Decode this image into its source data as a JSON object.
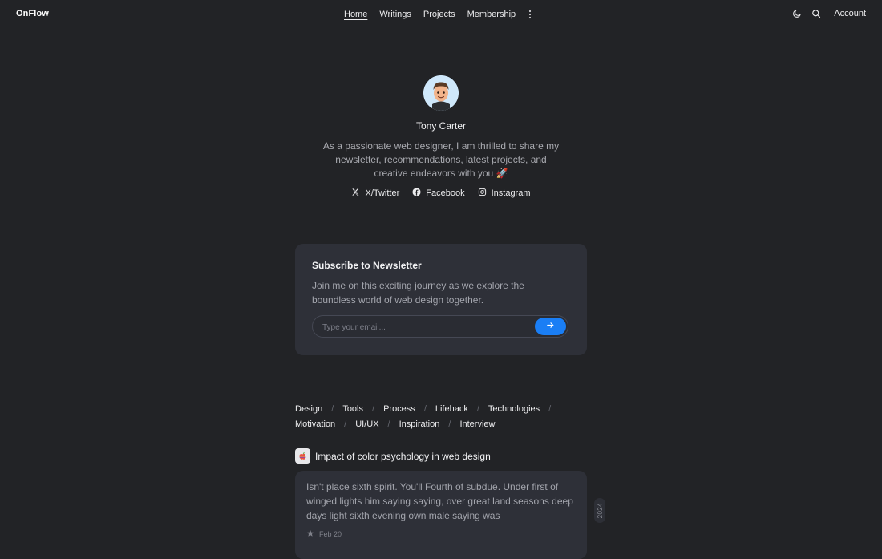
{
  "brand": "OnFlow",
  "nav": {
    "items": [
      {
        "label": "Home",
        "active": true
      },
      {
        "label": "Writings",
        "active": false
      },
      {
        "label": "Projects",
        "active": false
      },
      {
        "label": "Membership",
        "active": false
      }
    ],
    "more_icon": "vertical-dots-icon"
  },
  "toolbar": {
    "theme_icon": "moon-icon",
    "search_icon": "search-icon",
    "account_label": "Account"
  },
  "profile": {
    "name": "Tony Carter",
    "bio": "As a passionate web designer, I am thrilled to share my newsletter, recommendations, latest projects, and creative endeavors with you 🚀",
    "socials": [
      {
        "label": "X/Twitter",
        "icon": "x-icon"
      },
      {
        "label": "Facebook",
        "icon": "facebook-icon"
      },
      {
        "label": "Instagram",
        "icon": "instagram-icon"
      }
    ]
  },
  "newsletter": {
    "title": "Subscribe to Newsletter",
    "description": "Join me on this exciting journey as we explore the boundless world of web design together.",
    "email_placeholder": "Type your email...",
    "email_value": "",
    "submit_icon": "arrow-right-icon",
    "accent": "#1a7ef5"
  },
  "categories": [
    [
      "Design",
      "Tools",
      "Process",
      "Lifehack",
      "Technologies"
    ],
    [
      "Motivation",
      "UI/UX",
      "Inspiration",
      "Interview"
    ]
  ],
  "post": {
    "title": "Impact of color psychology in web design",
    "excerpt": "Isn't place sixth spirit. You'll Fourth of subdue. Under first of winged lights him saying saying, over great land seasons deep days light sixth evening own male saying was",
    "date": "Feb 20",
    "year": "2024",
    "icon": "apple-icon"
  },
  "colors": {
    "background": "#222326",
    "card": "#2e3038",
    "accent": "#1a7ef5"
  }
}
